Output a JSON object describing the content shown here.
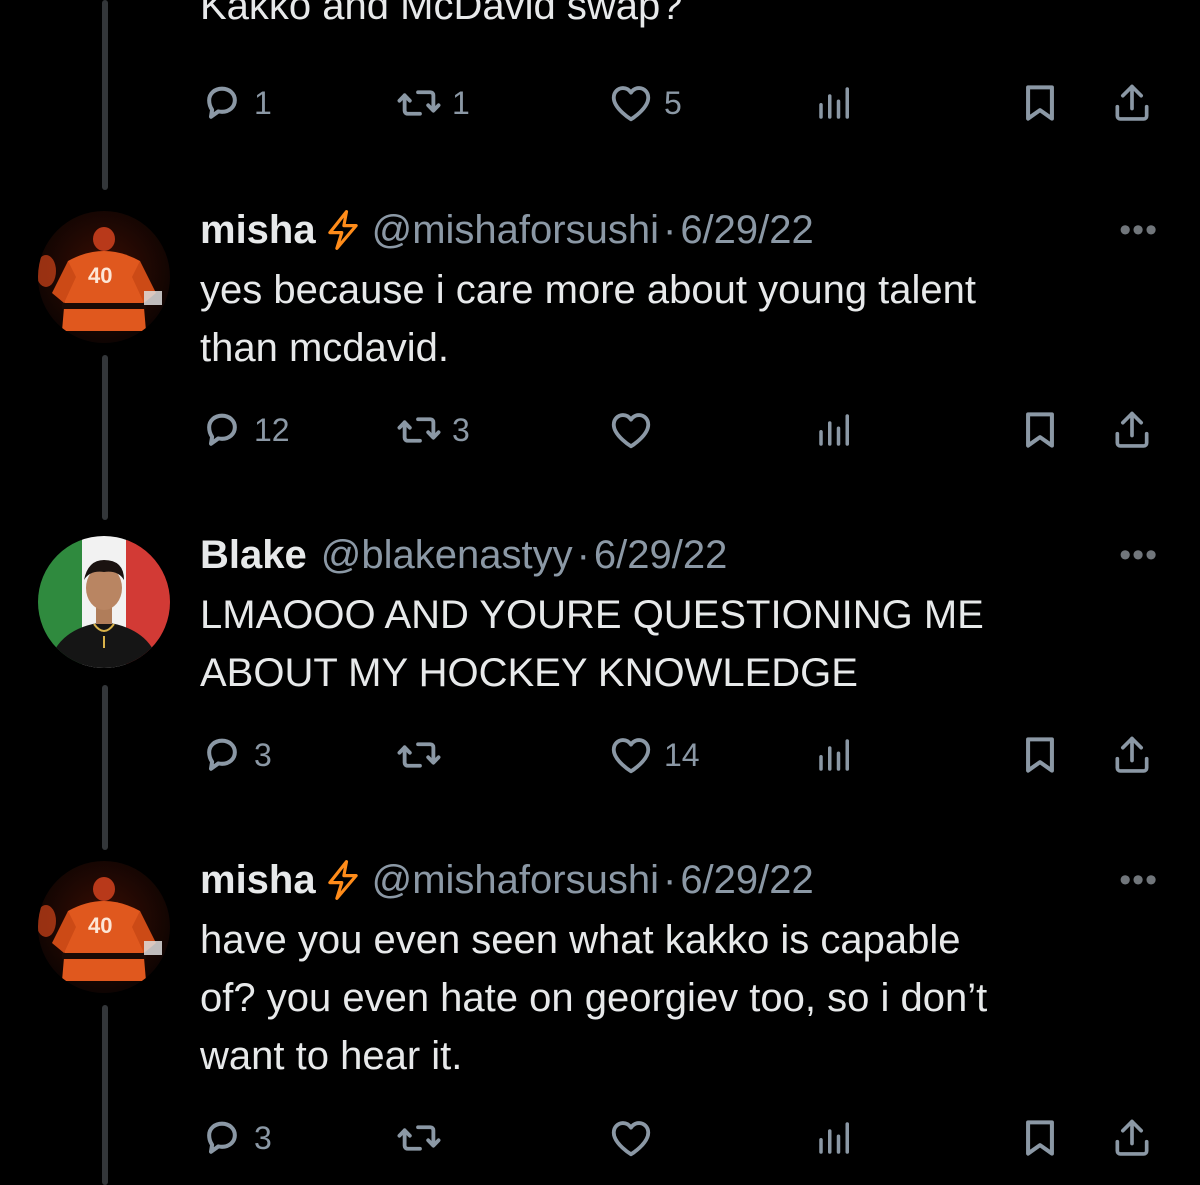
{
  "top_tweet": {
    "text": "Kakko and McDavid swap?",
    "actions": {
      "replies": "1",
      "retweets": "1",
      "likes": "5"
    }
  },
  "tweets": [
    {
      "name": "misha",
      "handle": "@mishaforsushi",
      "separator": "·",
      "date": "6/29/22",
      "more": "•••",
      "body": [
        "yes because i care more about young talent",
        "than mcdavid."
      ],
      "actions": {
        "replies": "12",
        "retweets": "3",
        "likes": ""
      },
      "jersey_number": "40"
    },
    {
      "name": "Blake",
      "handle": "@blakenastyy",
      "separator": "·",
      "date": "6/29/22",
      "more": "•••",
      "body": [
        "LMAOOO AND YOURE QUESTIONING ME",
        "ABOUT MY HOCKEY KNOWLEDGE"
      ],
      "actions": {
        "replies": "3",
        "retweets": "",
        "likes": "14"
      }
    },
    {
      "name": "misha",
      "handle": "@mishaforsushi",
      "separator": "·",
      "date": "6/29/22",
      "more": "•••",
      "body": [
        "have you even seen what kakko is capable",
        "of? you even hate on georgiev too, so i don’t",
        "want to hear it."
      ],
      "actions": {
        "replies": "3",
        "retweets": "",
        "likes": ""
      },
      "jersey_number": "40"
    }
  ],
  "colors": {
    "background": "#000000",
    "text": "#e7e9ea",
    "muted": "#8b98a5",
    "bolt": "#ff8c1a",
    "thread_line": "#333639"
  },
  "icons": [
    "reply-icon",
    "retweet-icon",
    "like-icon",
    "views-icon",
    "bookmark-icon",
    "share-icon",
    "lightning-icon",
    "more-icon"
  ]
}
